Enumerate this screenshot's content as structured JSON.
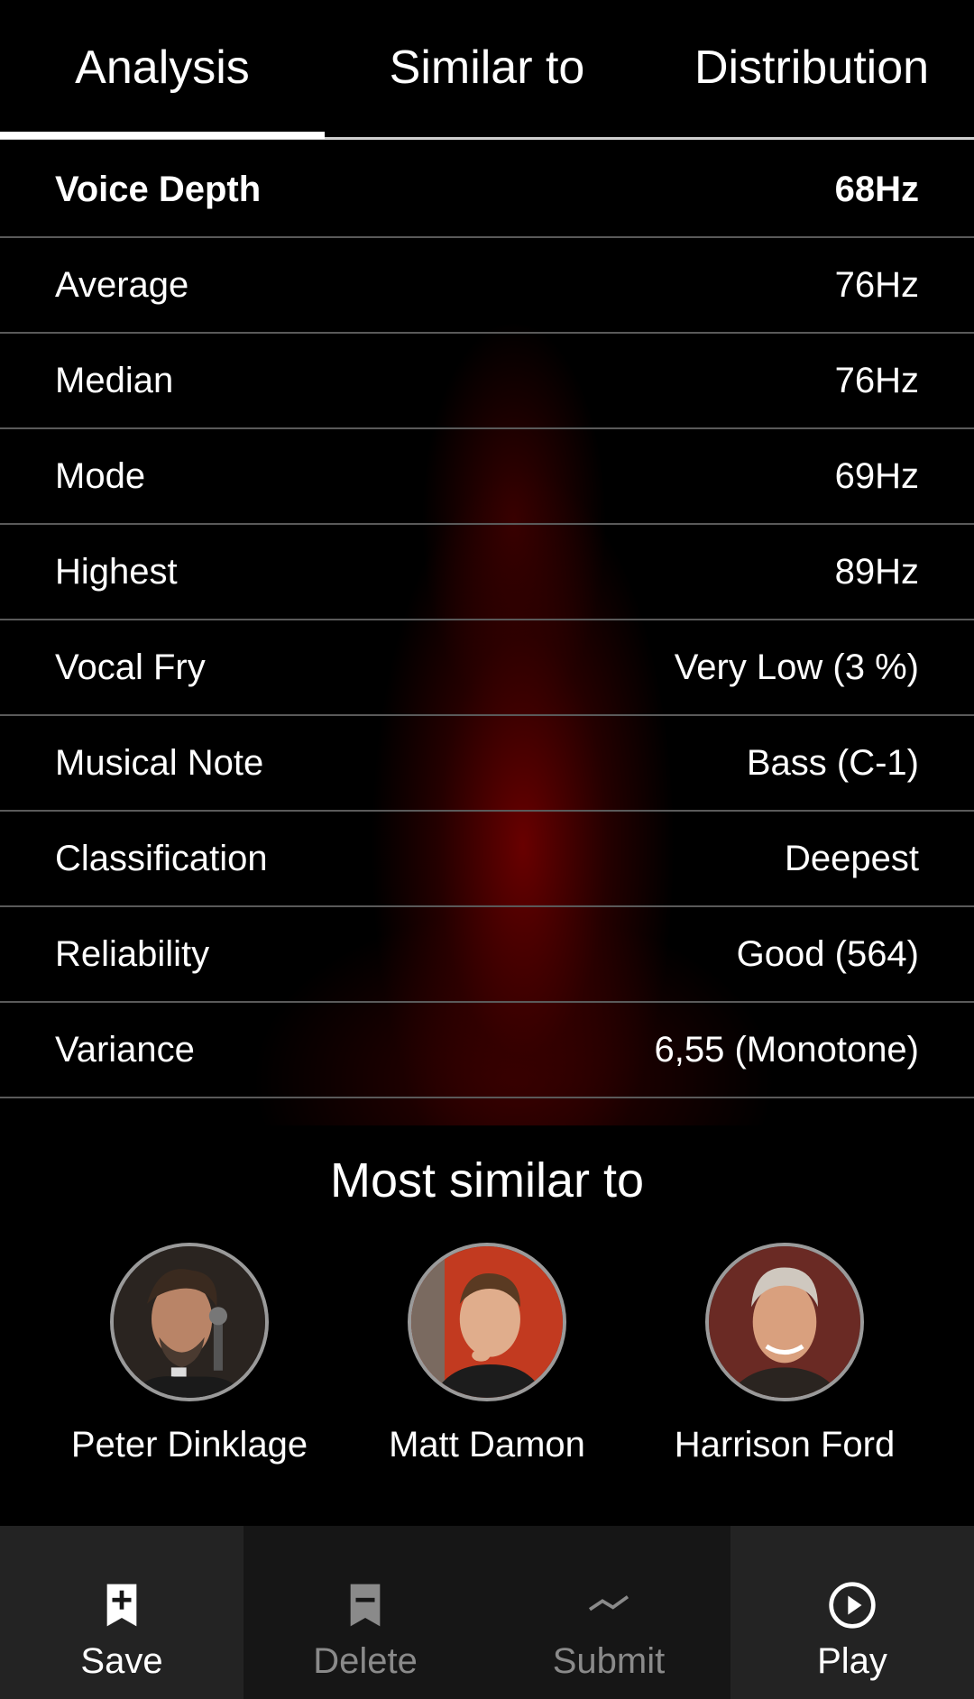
{
  "tabs": {
    "analysis": "Analysis",
    "similar": "Similar to",
    "distribution": "Distribution"
  },
  "analysis": {
    "rows": [
      {
        "label": "Voice Depth",
        "value": "68Hz"
      },
      {
        "label": "Average",
        "value": "76Hz"
      },
      {
        "label": "Median",
        "value": "76Hz"
      },
      {
        "label": "Mode",
        "value": "69Hz"
      },
      {
        "label": "Highest",
        "value": "89Hz"
      },
      {
        "label": "Vocal Fry",
        "value": "Very Low (3 %)"
      },
      {
        "label": "Musical Note",
        "value": "Bass (C-1)"
      },
      {
        "label": "Classification",
        "value": "Deepest"
      },
      {
        "label": "Reliability",
        "value": "Good (564)"
      },
      {
        "label": "Variance",
        "value": "6,55 (Monotone)"
      }
    ]
  },
  "similar": {
    "title": "Most similar to",
    "people": [
      {
        "name": "Peter Dinklage"
      },
      {
        "name": "Matt Damon"
      },
      {
        "name": "Harrison Ford"
      }
    ]
  },
  "bottom_bar": {
    "save": "Save",
    "delete": "Delete",
    "submit": "Submit",
    "play": "Play"
  },
  "colors": {
    "accent_glow": "#6e0000",
    "divider": "#5a5a5a",
    "disabled_text": "#8a8a8a"
  }
}
